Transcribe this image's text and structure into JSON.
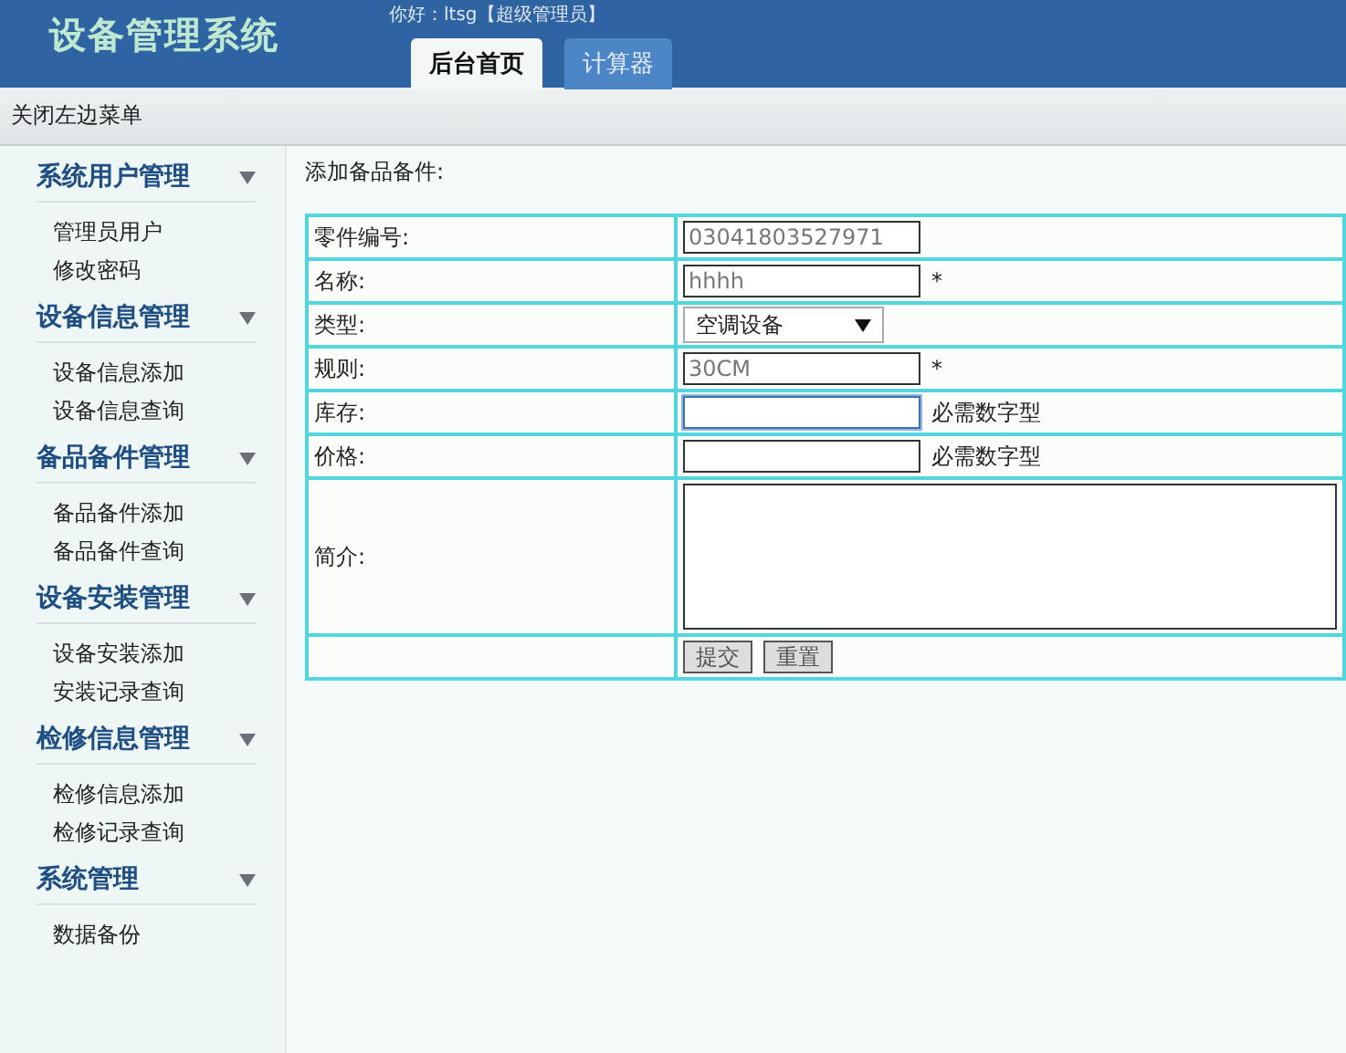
{
  "header": {
    "title": "设备管理系统",
    "greeting": "你好：ltsg【超级管理员】",
    "tabs": [
      {
        "label": "后台首页",
        "selected": true
      },
      {
        "label": "计算器",
        "selected": false
      }
    ]
  },
  "toolbar": {
    "toggle_link": "关闭左边菜单"
  },
  "sidebar": {
    "groups": [
      {
        "title": "系统用户管理",
        "expanded": true,
        "items": [
          "管理员用户",
          "修改密码"
        ]
      },
      {
        "title": "设备信息管理",
        "expanded": true,
        "items": [
          "设备信息添加",
          "设备信息查询"
        ]
      },
      {
        "title": "备品备件管理",
        "expanded": true,
        "items": [
          "备品备件添加",
          "备品备件查询"
        ]
      },
      {
        "title": "设备安装管理",
        "expanded": true,
        "items": [
          "设备安装添加",
          "安装记录查询"
        ]
      },
      {
        "title": "检修信息管理",
        "expanded": true,
        "items": [
          "检修信息添加",
          "检修记录查询"
        ]
      },
      {
        "title": "系统管理",
        "expanded": true,
        "items": [
          "数据备份"
        ]
      }
    ]
  },
  "form": {
    "title": "添加备品备件:",
    "rows": [
      {
        "kind": "text",
        "label": "零件编号:",
        "value": "03041803527971",
        "readonly": true,
        "focused": false
      },
      {
        "kind": "text",
        "label": "名称:",
        "value": "hhhh",
        "readonly": true,
        "focused": false,
        "note": "*"
      },
      {
        "kind": "select",
        "label": "类型:",
        "value": "空调设备"
      },
      {
        "kind": "text",
        "label": "规则:",
        "value": "30CM",
        "readonly": true,
        "focused": false,
        "note": "*"
      },
      {
        "kind": "text",
        "label": "库存:",
        "focused": true,
        "note": "必需数字型"
      },
      {
        "kind": "text",
        "label": "价格:",
        "focused": false,
        "note": "必需数字型"
      },
      {
        "kind": "textarea",
        "label": "简介:"
      },
      {
        "kind": "buttons",
        "buttons": [
          "提交",
          "重置"
        ]
      }
    ]
  }
}
